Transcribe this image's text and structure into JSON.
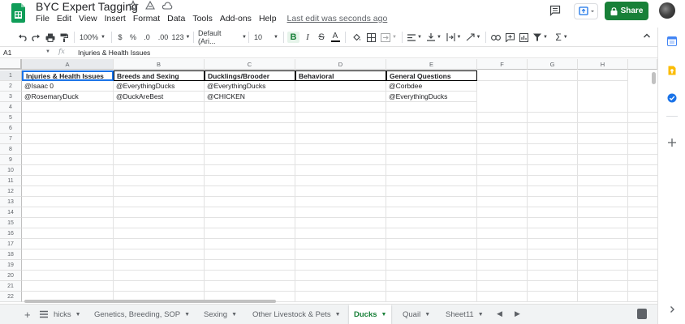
{
  "title_bar": {
    "doc_title": "BYC Expert Tagging",
    "menu": [
      "File",
      "Edit",
      "View",
      "Insert",
      "Format",
      "Data",
      "Tools",
      "Add-ons",
      "Help"
    ],
    "last_edit": "Last edit was seconds ago",
    "share_label": "Share",
    "icons": [
      "sheets-logo-icon",
      "star-icon",
      "move-to-folder-icon",
      "cloud-saved-icon",
      "comments-icon",
      "present-icon",
      "lock-icon",
      "avatar"
    ]
  },
  "toolbar": {
    "zoom": "100%",
    "currency": "$",
    "percent": "%",
    "dec_decrease": ".0",
    "dec_increase": ".00",
    "more_formats": "123",
    "font": "Default (Ari...",
    "font_size": "10"
  },
  "formula_bar": {
    "name_box": "A1",
    "fx": "fx",
    "value": "Injuries & Health Issues"
  },
  "grid": {
    "columns": [
      "A",
      "B",
      "C",
      "D",
      "E",
      "F",
      "G",
      "H"
    ],
    "rows": [
      "1",
      "2",
      "3",
      "4",
      "5",
      "6",
      "7",
      "8",
      "9",
      "10",
      "11",
      "12",
      "13",
      "14",
      "15",
      "16",
      "17",
      "18",
      "19",
      "20",
      "21",
      "22"
    ],
    "headers": [
      "Injuries & Health Issues",
      "Breeds and Sexing",
      "Ducklings/Brooder",
      "Behavioral",
      "General Questions"
    ],
    "row2": [
      "@Isaac 0",
      "@EverythingDucks",
      "@EverythingDucks",
      "",
      "@Corbdee"
    ],
    "row3": [
      "@RosemaryDuck",
      "@DuckAreBest",
      "@CHICKEN",
      "",
      "@EverythingDucks"
    ]
  },
  "sheets": {
    "add": "+",
    "tabs": [
      {
        "label": "hicks",
        "active": false
      },
      {
        "label": "Genetics, Breeding, SOP",
        "active": false
      },
      {
        "label": "Sexing",
        "active": false
      },
      {
        "label": "Other Livestock & Pets",
        "active": false
      },
      {
        "label": "Ducks",
        "active": true
      },
      {
        "label": "Quail",
        "active": false
      },
      {
        "label": "Sheet11",
        "active": false
      }
    ]
  },
  "colors": {
    "share_green": "#188038",
    "selection_blue": "#1a73e8",
    "active_tab_green": "#188038",
    "calendar_blue": "#4285f4",
    "keep_yellow": "#fbbc04",
    "tasks_blue": "#1a73e8"
  }
}
